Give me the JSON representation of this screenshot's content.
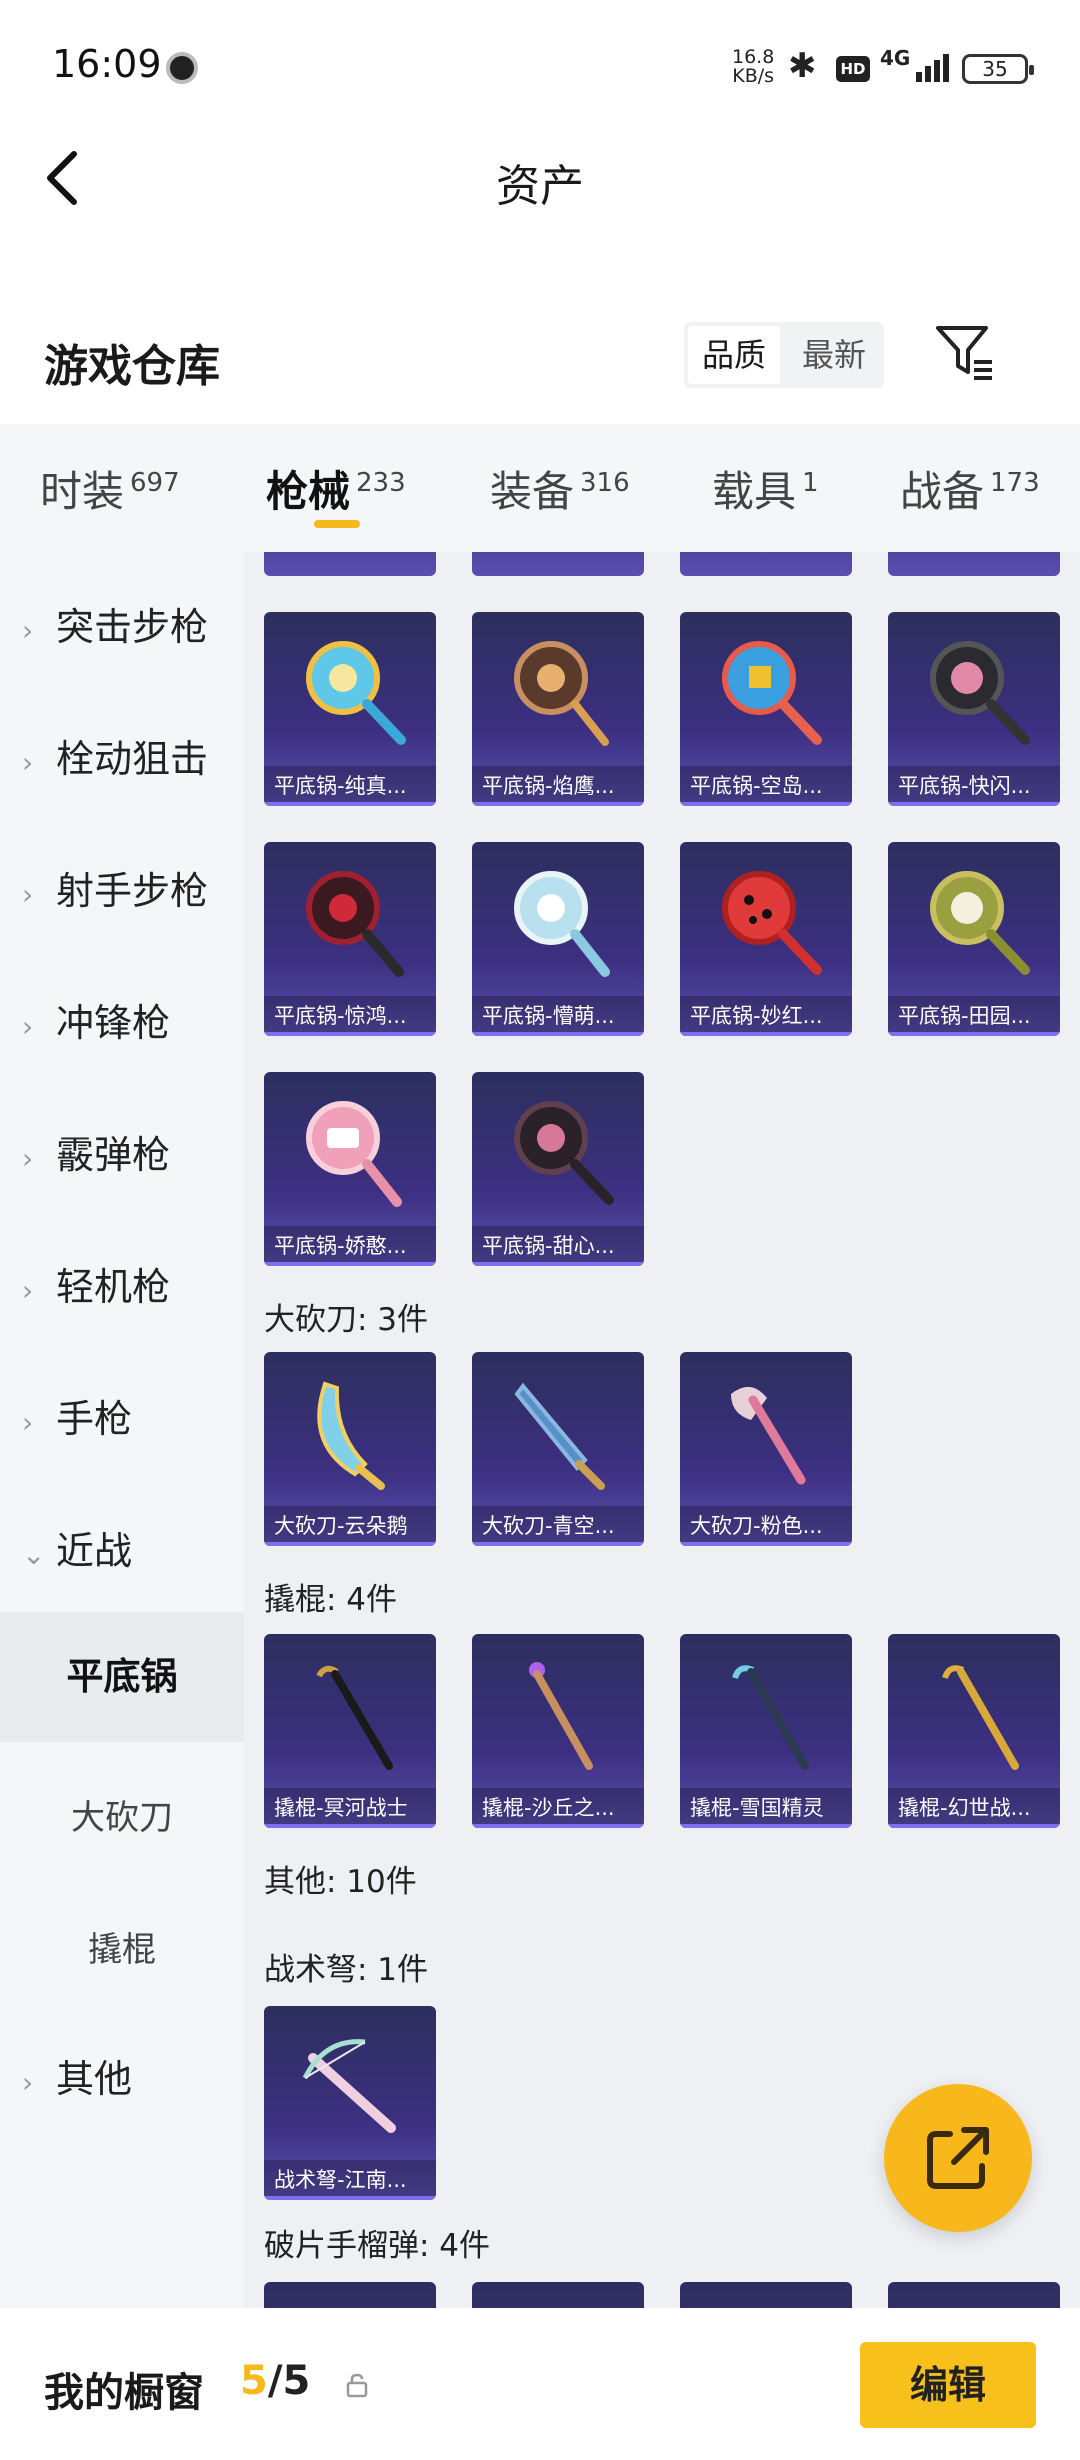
{
  "status_bar": {
    "time": "16:09",
    "speed_value": "16.8",
    "speed_unit": "KB/s",
    "network": "4G",
    "battery": "35",
    "hd": "HD"
  },
  "header": {
    "title": "资产"
  },
  "section": {
    "title": "游戏仓库",
    "sort_quality": "品质",
    "sort_latest": "最新"
  },
  "tabs": [
    {
      "label": "时装",
      "count": "697"
    },
    {
      "label": "枪械",
      "count": "233"
    },
    {
      "label": "装备",
      "count": "316"
    },
    {
      "label": "载具",
      "count": "1"
    },
    {
      "label": "战备",
      "count": "173"
    }
  ],
  "sidebar": {
    "categories": [
      "突击步枪",
      "栓动狙击",
      "射手步枪",
      "冲锋枪",
      "霰弹枪",
      "轻机枪",
      "手枪",
      "近战",
      "其他"
    ],
    "sub_items": [
      "平底锅",
      "大砍刀",
      "撬棍"
    ]
  },
  "content": {
    "pans": [
      "平底锅-纯真...",
      "平底锅-焰鹰...",
      "平底锅-空岛...",
      "平底锅-快闪...",
      "平底锅-惊鸿...",
      "平底锅-懵萌...",
      "平底锅-妙红...",
      "平底锅-田园...",
      "平底锅-娇憨...",
      "平底锅-甜心..."
    ],
    "machete_group": "大砍刀: 3件",
    "machetes": [
      "大砍刀-云朵鹅",
      "大砍刀-青空...",
      "大砍刀-粉色..."
    ],
    "crowbar_group": "撬棍: 4件",
    "crowbars": [
      "撬棍-冥河战士",
      "撬棍-沙丘之...",
      "撬棍-雪国精灵",
      "撬棍-幻世战..."
    ],
    "other_group": "其他: 10件",
    "crossbow_group": "战术弩: 1件",
    "crossbows": [
      "战术弩-江南..."
    ],
    "grenade_group": "破片手榴弹: 4件"
  },
  "bottom_bar": {
    "title": "我的橱窗",
    "current": "5",
    "total": "/5",
    "edit_label": "编辑"
  },
  "colors": {
    "accent": "#f5b91a",
    "card_bg": "#3c2f80",
    "label_border": "#7d6ff0"
  }
}
